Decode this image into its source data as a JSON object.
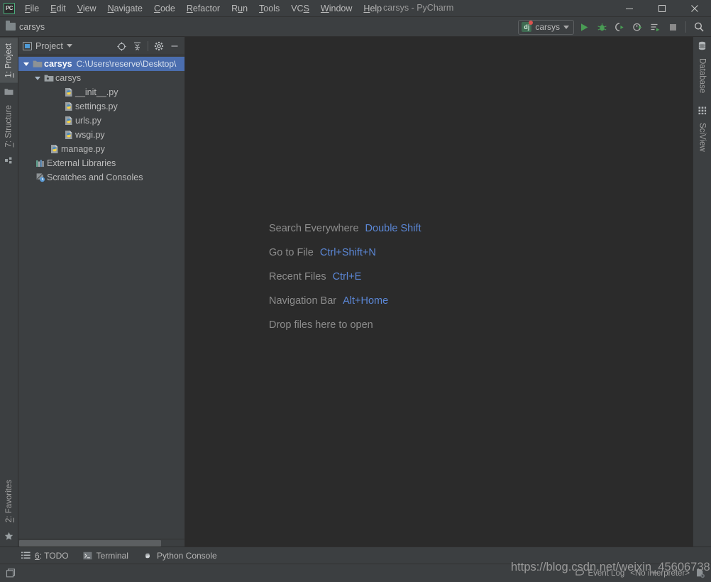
{
  "window": {
    "app_logo": "pycharm-logo",
    "title": "carsys - PyCharm",
    "minimize_label": "minimize-icon",
    "maximize_label": "maximize-icon",
    "close_label": "close-icon"
  },
  "menubar": {
    "items": [
      {
        "label": "File",
        "mnemonic": "F"
      },
      {
        "label": "Edit",
        "mnemonic": "E"
      },
      {
        "label": "View",
        "mnemonic": "V"
      },
      {
        "label": "Navigate",
        "mnemonic": "N"
      },
      {
        "label": "Code",
        "mnemonic": "C"
      },
      {
        "label": "Refactor",
        "mnemonic": "R"
      },
      {
        "label": "Run",
        "mnemonic": "u"
      },
      {
        "label": "Tools",
        "mnemonic": "T"
      },
      {
        "label": "VCS",
        "mnemonic": "S"
      },
      {
        "label": "Window",
        "mnemonic": "W"
      },
      {
        "label": "Help",
        "mnemonic": "H"
      }
    ]
  },
  "navbar": {
    "breadcrumb": "carsys",
    "breadcrumb_icon": "folder-icon",
    "run_config": {
      "name": "carsys",
      "icon": "django-config-icon",
      "dropdown_icon": "chevron-down-icon"
    },
    "buttons": [
      {
        "name": "run-button",
        "icon": "run-icon"
      },
      {
        "name": "debug-button",
        "icon": "debug-bug-icon"
      },
      {
        "name": "run-coverage-button",
        "icon": "coverage-icon"
      },
      {
        "name": "profile-button",
        "icon": "profile-icon"
      },
      {
        "name": "run-with-console-button",
        "icon": "run-console-icon"
      },
      {
        "name": "stop-button",
        "icon": "stop-square-icon"
      },
      {
        "name": "search-button",
        "icon": "search-icon"
      }
    ]
  },
  "left_strip": {
    "tabs": [
      {
        "label": "1: Project",
        "mnemonic": "1",
        "active": true,
        "icon": "project-icon"
      },
      {
        "label": "7: Structure",
        "mnemonic": "7",
        "active": false,
        "icon": "structure-icon"
      }
    ],
    "bottom_tabs": [
      {
        "label": "2: Favorites",
        "mnemonic": "2",
        "active": false,
        "icon": "star-icon"
      }
    ]
  },
  "right_strip": {
    "tabs": [
      {
        "label": "Database",
        "icon": "database-icon"
      },
      {
        "label": "SciView",
        "icon": "sciview-grid-icon"
      }
    ]
  },
  "project_panel": {
    "title": "Project",
    "title_icon": "project-view-icon",
    "dropdown_icon": "chevron-down-icon",
    "actions": [
      {
        "name": "select-opened-file-button",
        "icon": "locate-target-icon"
      },
      {
        "name": "collapse-all-button",
        "icon": "collapse-all-icon"
      },
      {
        "name": "settings-button",
        "icon": "gear-icon"
      },
      {
        "name": "hide-button",
        "icon": "minimize-icon"
      }
    ],
    "tree": [
      {
        "label": "carsys",
        "path": "C:\\Users\\reserve\\Desktop\\",
        "indent": 0,
        "expanded": true,
        "selected": true,
        "icon": "project-root-folder-icon",
        "bold": true
      },
      {
        "label": "carsys",
        "path": "",
        "indent": 1,
        "expanded": true,
        "selected": false,
        "icon": "source-folder-icon",
        "bold": false
      },
      {
        "label": "__init__.py",
        "path": "",
        "indent": 3,
        "expanded": null,
        "selected": false,
        "icon": "python-file-icon",
        "bold": false
      },
      {
        "label": "settings.py",
        "path": "",
        "indent": 3,
        "expanded": null,
        "selected": false,
        "icon": "python-file-icon",
        "bold": false
      },
      {
        "label": "urls.py",
        "path": "",
        "indent": 3,
        "expanded": null,
        "selected": false,
        "icon": "python-file-icon",
        "bold": false
      },
      {
        "label": "wsgi.py",
        "path": "",
        "indent": 3,
        "expanded": null,
        "selected": false,
        "icon": "python-file-icon",
        "bold": false
      },
      {
        "label": "manage.py",
        "path": "",
        "indent": 2,
        "expanded": null,
        "selected": false,
        "icon": "python-file-icon",
        "bold": false
      },
      {
        "label": "External Libraries",
        "path": "",
        "indent": 1,
        "expanded": null,
        "selected": false,
        "icon": "external-libraries-icon",
        "bold": false
      },
      {
        "label": "Scratches and Consoles",
        "path": "",
        "indent": 1,
        "expanded": null,
        "selected": false,
        "icon": "scratches-icon",
        "bold": false
      }
    ]
  },
  "editor": {
    "tips": [
      {
        "action": "Search Everywhere",
        "shortcut": "Double Shift"
      },
      {
        "action": "Go to File",
        "shortcut": "Ctrl+Shift+N"
      },
      {
        "action": "Recent Files",
        "shortcut": "Ctrl+E"
      },
      {
        "action": "Navigation Bar",
        "shortcut": "Alt+Home"
      },
      {
        "action": "Drop files here to open",
        "shortcut": ""
      }
    ]
  },
  "bottom_strip": {
    "tabs": [
      {
        "label": "6: TODO",
        "mnemonic": "6",
        "icon": "todo-list-icon"
      },
      {
        "label": "Terminal",
        "mnemonic": "",
        "icon": "terminal-icon"
      },
      {
        "label": "Python Console",
        "mnemonic": "",
        "icon": "python-console-icon"
      }
    ]
  },
  "statusbar": {
    "layout_icon": "layout-toggle-icon",
    "event_log": "Event Log",
    "event_log_icon": "event-log-balloon-icon",
    "interpreter": "<No interpreter>",
    "interpreter_icon": "interpreter-gear-icon"
  },
  "watermark": {
    "text": "https://blog.csdn.net/weixin_45606738"
  },
  "colors": {
    "panel_bg": "#3c3f41",
    "editor_bg": "#2b2b2b",
    "selection_blue": "#4b6eaf",
    "accent_link": "#5b87d6",
    "text": "#bbbbbb",
    "run_green": "#499c54"
  }
}
